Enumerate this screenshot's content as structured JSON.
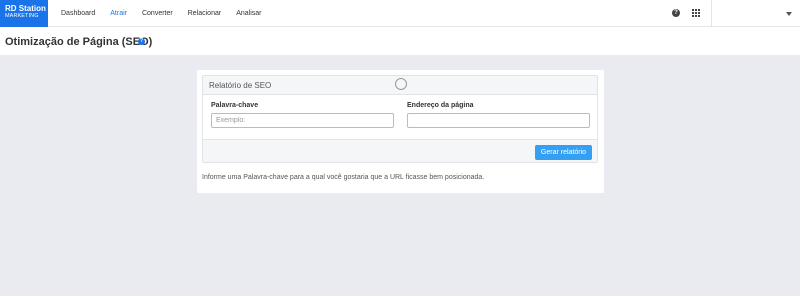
{
  "brand": {
    "name": "RD Station",
    "sub": "MARKETING"
  },
  "nav": {
    "items": [
      {
        "label": "Dashboard",
        "active": false
      },
      {
        "label": "Atrair",
        "active": true
      },
      {
        "label": "Converter",
        "active": false
      },
      {
        "label": "Relacionar",
        "active": false
      },
      {
        "label": "Analisar",
        "active": false
      }
    ],
    "help_glyph": "?"
  },
  "page": {
    "title": "Otimização de Página (SEO)",
    "help_glyph": "?"
  },
  "report": {
    "panel_title": "Relatório de SEO",
    "keyword": {
      "label": "Palavra-chave",
      "placeholder": "Exemplo:",
      "value": ""
    },
    "address": {
      "label": "Endereço da página",
      "placeholder": "",
      "value": ""
    },
    "button_label": "Gerar relatório",
    "help_text": "Informe uma Palavra-chave para a qual você gostaria que a URL ficasse bem posicionada."
  },
  "colors": {
    "accent": "#1a73e8",
    "button": "#35a0f2",
    "background": "#e9ebf1"
  },
  "icons": [
    "help-icon",
    "apps-grid-icon",
    "caret-down-icon",
    "spinner-icon"
  ]
}
